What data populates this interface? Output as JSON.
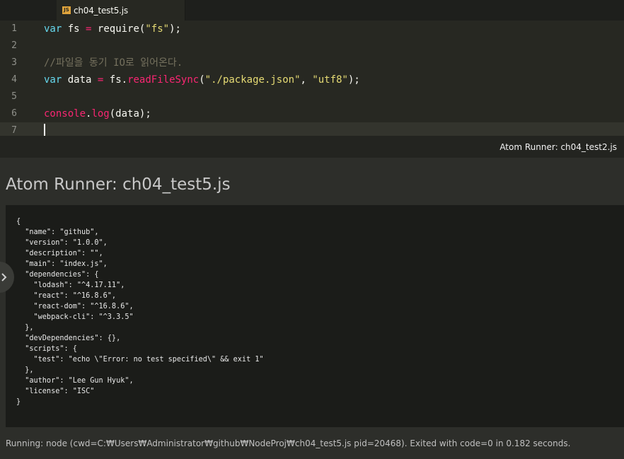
{
  "tab": {
    "icon": "js-file-icon",
    "icon_text": "JS",
    "title": "ch04_test5.js"
  },
  "editor": {
    "lines": [
      {
        "number": "1"
      },
      {
        "number": "2"
      },
      {
        "number": "3",
        "comment": "//파일을 동기 IO로 읽어온다."
      },
      {
        "number": "4"
      },
      {
        "number": "5"
      },
      {
        "number": "6"
      },
      {
        "number": "7"
      }
    ],
    "tokens": {
      "var": "var",
      "fs": "fs",
      "eq": "=",
      "require": "require(",
      "fs_str": "\"fs\"",
      "close_semi": ");",
      "data": "data",
      "fs_dot": "fs.",
      "read": "readFileSync",
      "open": "(",
      "path_str": "\"./package.json\"",
      "comma": ", ",
      "enc_str": "\"utf8\"",
      "console": "console",
      "dot": ".",
      "log": "log",
      "log_args": "(data);"
    }
  },
  "runner_strip": {
    "label": "Atom Runner: ch04_test2.js"
  },
  "runner": {
    "title": "Atom Runner: ch04_test5.js",
    "output": [
      "{",
      "  \"name\": \"github\",",
      "  \"version\": \"1.0.0\",",
      "  \"description\": \"\",",
      "  \"main\": \"index.js\",",
      "  \"dependencies\": {",
      "    \"lodash\": \"^4.17.11\",",
      "    \"react\": \"^16.8.6\",",
      "    \"react-dom\": \"^16.8.6\",",
      "    \"webpack-cli\": \"^3.3.5\"",
      "  },",
      "  \"devDependencies\": {},",
      "  \"scripts\": {",
      "    \"test\": \"echo \\\"Error: no test specified\\\" && exit 1\"",
      "  },",
      "  \"author\": \"Lee Gun Hyuk\",",
      "  \"license\": \"ISC\"",
      "}"
    ],
    "footer": "Running: node (cwd=C:₩Users₩Administrator₩github₩NodeProj₩ch04_test5.js pid=20468). Exited with code=0 in 0.182 seconds."
  }
}
